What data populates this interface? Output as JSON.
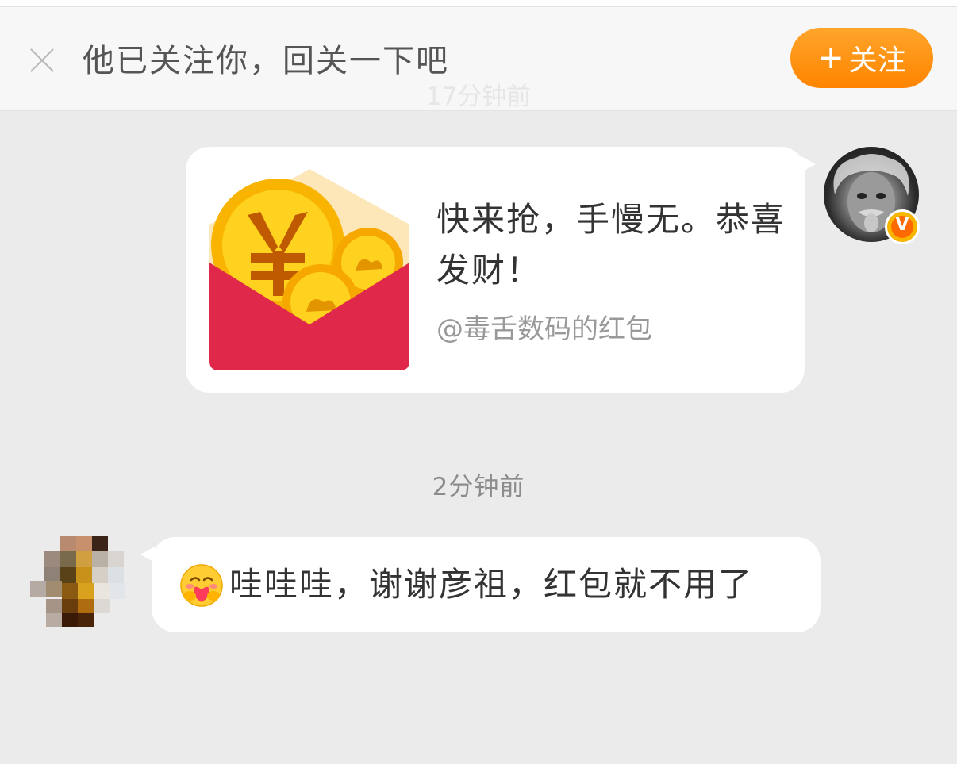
{
  "follow_bar": {
    "text": "他已关注你，回关一下吧",
    "button_label": "关注",
    "button_plus": "+"
  },
  "timestamps": {
    "faded": "17分钟前",
    "recent": "2分钟前"
  },
  "red_packet": {
    "title": "快来抢，手慢无。恭喜发财！",
    "from": "@毒舌数码的红包",
    "badge_letter": "V"
  },
  "reply": {
    "text": "哇哇哇，谢谢彦祖，红包就不用了"
  },
  "icons": {
    "close": "close-icon",
    "envelope": "red-envelope-icon",
    "emoji": "hugging-face-emoji",
    "verified": "verified-badge-icon"
  },
  "colors": {
    "accent_orange": "#ff8a00",
    "envelope_red": "#e0294a",
    "coin_yellow": "#ffcc00",
    "background": "#ebebeb"
  }
}
